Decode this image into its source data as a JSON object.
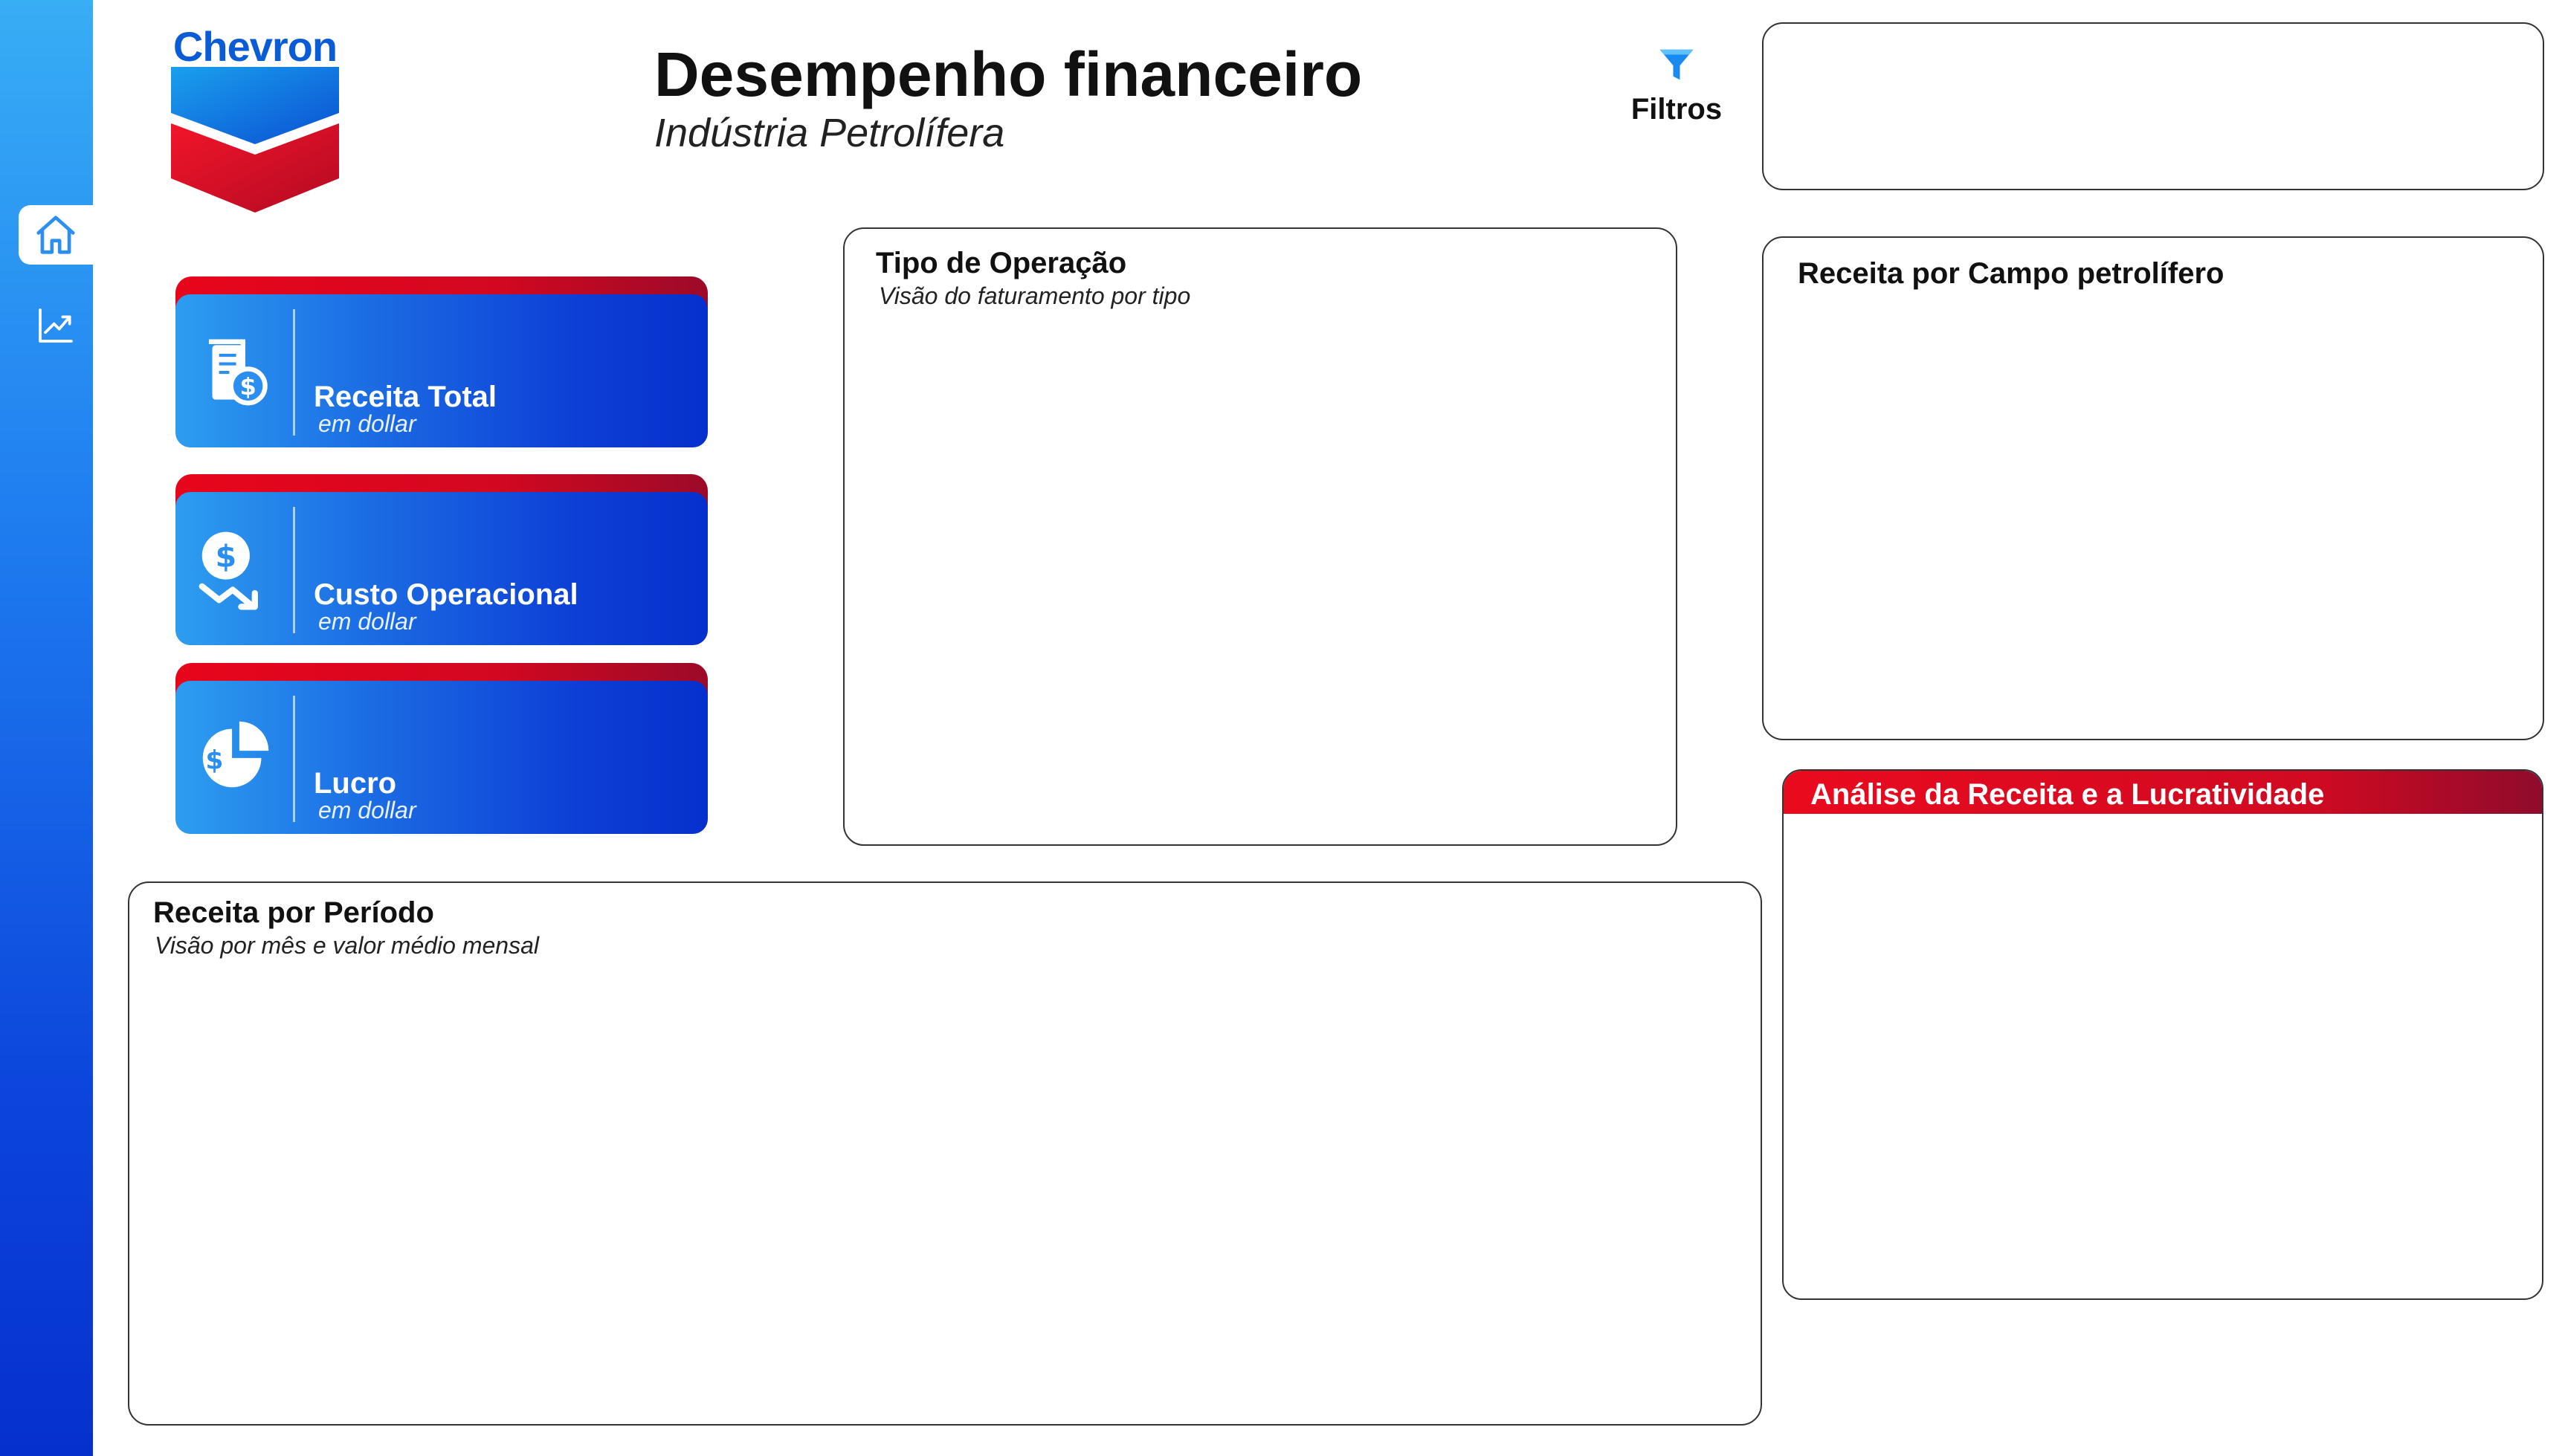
{
  "brand": {
    "name": "Chevron"
  },
  "header": {
    "title": "Desempenho financeiro",
    "subtitle": "Indústria Petrolífera",
    "filter_label": "Filtros"
  },
  "sidebar": {
    "items": [
      {
        "icon": "home-icon",
        "active": true
      },
      {
        "icon": "trend-chart-icon",
        "active": false
      }
    ]
  },
  "kpis": [
    {
      "label": "Receita Total",
      "unit": "em dollar",
      "icon": "revenue-document-dollar-icon"
    },
    {
      "label": "Custo Operacional",
      "unit": "em dollar",
      "icon": "dollar-decrease-icon"
    },
    {
      "label": "Lucro",
      "unit": "em dollar",
      "icon": "dollar-pie-icon"
    }
  ],
  "panels": {
    "tipo_operacao": {
      "title": "Tipo de Operação",
      "subtitle": "Visão do faturamento por tipo"
    },
    "receita_campo": {
      "title": "Receita por Campo petrolífero"
    },
    "receita_periodo": {
      "title": "Receita por Período",
      "subtitle": "Visão por mês e valor médio mensal"
    },
    "analise": {
      "title": "Análise da Receita e a Lucratividade"
    }
  },
  "colors": {
    "brand_blue": "#0a5cd6",
    "accent_red": "#e8051c",
    "sidebar_gradient_top": "#38aef5",
    "sidebar_gradient_bottom": "#0630cc"
  }
}
